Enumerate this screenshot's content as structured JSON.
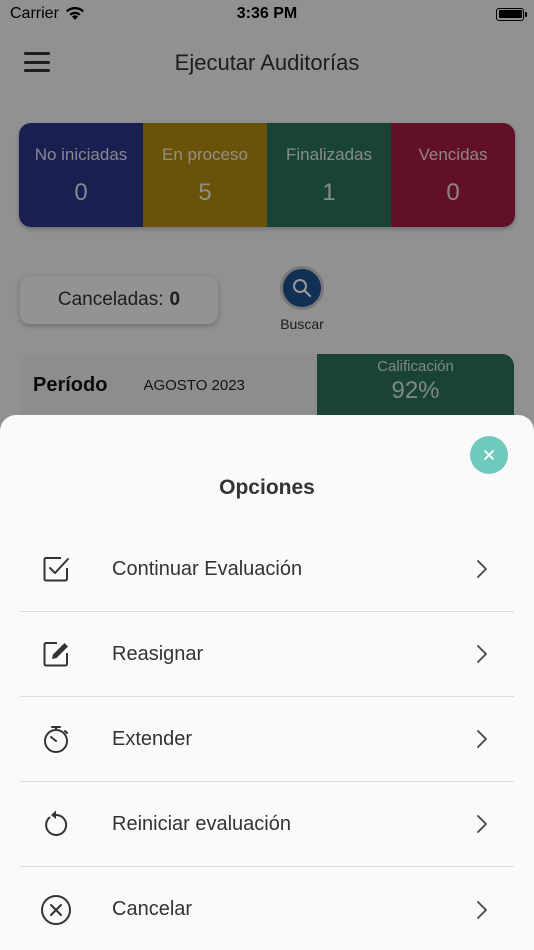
{
  "status_bar": {
    "carrier": "Carrier",
    "time": "3:36 PM"
  },
  "header": {
    "title": "Ejecutar Auditorías"
  },
  "stats": [
    {
      "label": "No iniciadas",
      "value": "0"
    },
    {
      "label": "En proceso",
      "value": "5"
    },
    {
      "label": "Finalizadas",
      "value": "1"
    },
    {
      "label": "Vencidas",
      "value": "0"
    }
  ],
  "cancelled": {
    "label": "Canceladas:",
    "count": "0"
  },
  "search": {
    "label": "Buscar"
  },
  "period": {
    "title": "Período",
    "month": "AGOSTO 2023",
    "grade_label": "Calificación",
    "grade_value": "92%"
  },
  "sheet": {
    "title": "Opciones",
    "options": [
      {
        "label": "Continuar Evaluación",
        "icon": "checkbox-icon"
      },
      {
        "label": "Reasignar",
        "icon": "edit-icon"
      },
      {
        "label": "Extender",
        "icon": "timer-icon"
      },
      {
        "label": "Reiniciar evaluación",
        "icon": "restart-icon"
      },
      {
        "label": "Cancelar",
        "icon": "cancel-circle-icon"
      }
    ]
  },
  "colors": {
    "not_started": "#2a3487",
    "in_process": "#b08a10",
    "finished": "#2a7059",
    "overdue": "#a31b3f",
    "close_button": "#6fc9bd"
  }
}
